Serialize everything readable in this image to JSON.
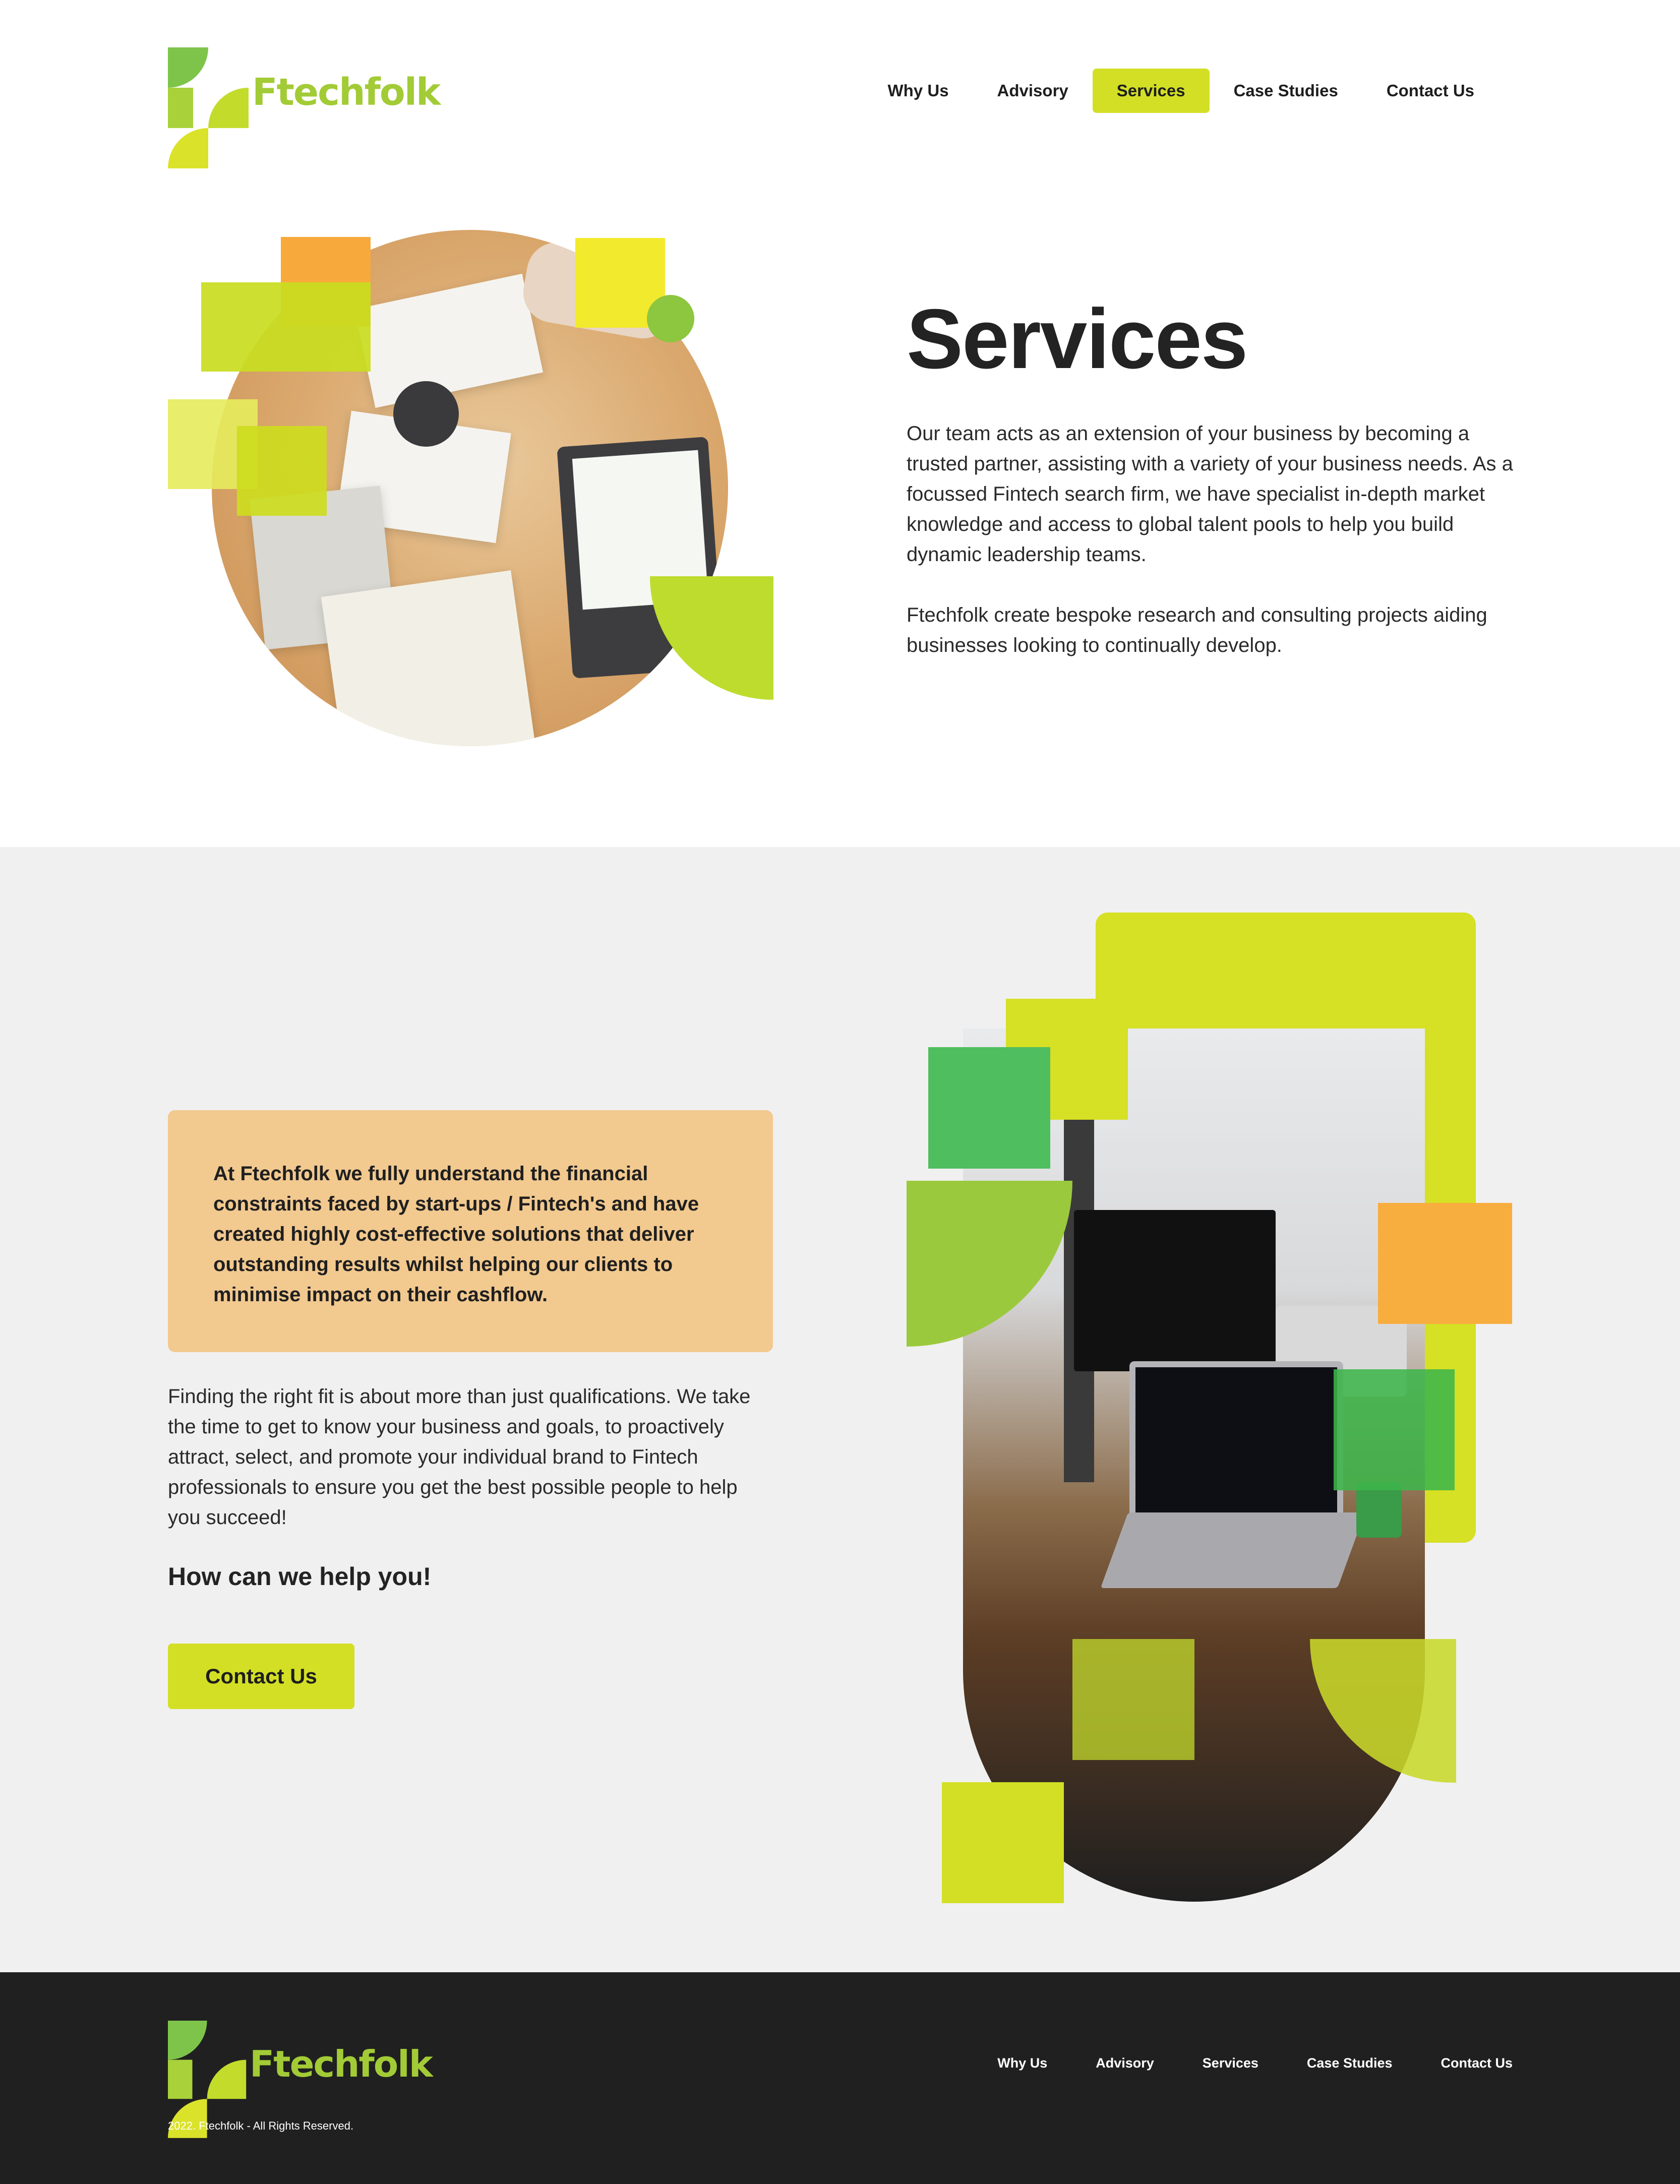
{
  "brand": {
    "name": "Ftechfolk",
    "colors": {
      "lime": "#d3df25",
      "green": "#a2cb36",
      "orange": "#f2c98f",
      "dark": "#202020"
    }
  },
  "header": {
    "nav": [
      {
        "label": "Why Us",
        "active": false
      },
      {
        "label": "Advisory",
        "active": false
      },
      {
        "label": "Services",
        "active": true
      },
      {
        "label": "Case Studies",
        "active": false
      },
      {
        "label": "Contact Us",
        "active": false
      }
    ]
  },
  "hero": {
    "title": "Services",
    "paragraph1": "Our team acts as an extension of your business by becoming a trusted partner, assisting with a variety of your business needs. As a focussed Fintech search firm, we have specialist in-depth market knowledge and access to global talent pools to help you build dynamic leadership teams.",
    "paragraph2": "Ftechfolk create bespoke research and consulting projects aiding businesses looking to continually develop."
  },
  "middle": {
    "callout": "At Ftechfolk we fully understand the financial constraints faced by start-ups / Fintech's and have created highly cost-effective solutions that deliver outstanding results whilst helping our clients to minimise impact on their cashflow.",
    "paragraph": "Finding the right fit is about more than just qualifications. We take the time to get to know your business and goals, to proactively attract, select, and promote your individual brand to Fintech professionals to ensure you get the best possible people to help you succeed!",
    "heading": "How can we help you!",
    "cta_label": "Contact Us"
  },
  "footer": {
    "nav": [
      "Why Us",
      "Advisory",
      "Services",
      "Case Studies",
      "Contact Us"
    ],
    "copyright": "2022. Ftechfolk - All Rights Reserved."
  }
}
